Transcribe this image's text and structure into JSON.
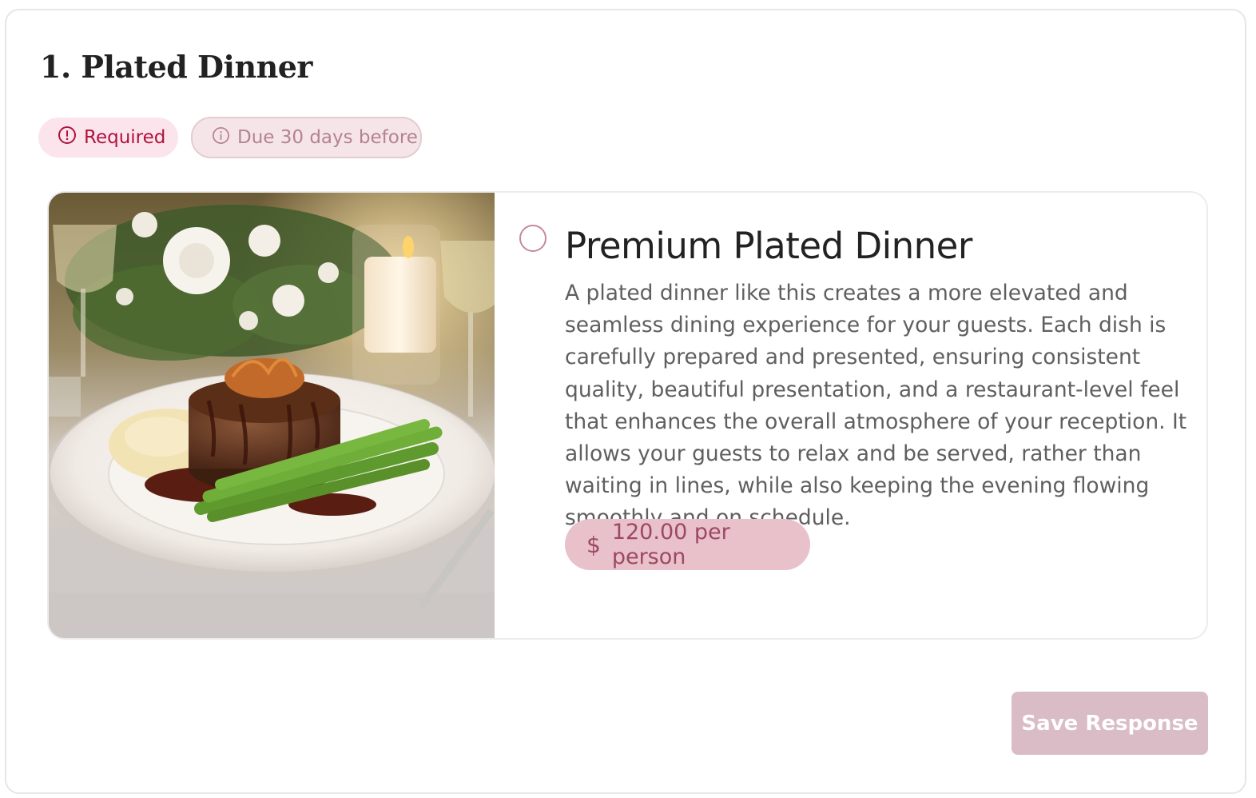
{
  "section": {
    "title": "1. Plated Dinner",
    "badges": {
      "required": "Required",
      "due": "Due 30 days before"
    }
  },
  "option": {
    "title": "Premium Plated Dinner",
    "description": "A plated dinner like this creates a more elevated and seamless dining experience for your guests. Each dish is carefully prepared and presented, ensuring consistent quality, beautiful presentation, and a restaurant-level feel that enhances the overall atmosphere of your reception. It allows your guests to relax and be served, rather than waiting in lines, while also keeping the evening flowing smoothly and on schedule.",
    "price": {
      "currency_symbol": "$",
      "label": "120.00 per person"
    },
    "selected": false,
    "image_icon": "plated-dinner-photo"
  },
  "actions": {
    "save_label": "Save Response"
  },
  "colors": {
    "required_bg": "#fce4ec",
    "required_text": "#b0123e",
    "due_bg": "#f6e5e8",
    "due_text": "#b4838f",
    "price_bg": "#e8c1cb",
    "price_text": "#9e4863",
    "button_bg": "#d9bcc6"
  },
  "icons": {
    "required": "alert-circle-icon",
    "due": "info-circle-icon",
    "price": "dollar-icon"
  }
}
